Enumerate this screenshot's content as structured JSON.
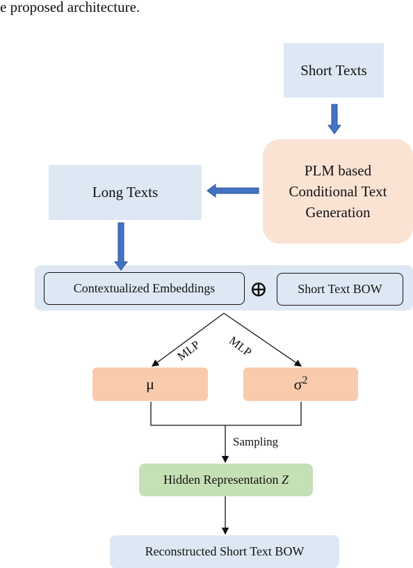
{
  "caption": "e proposed architecture.",
  "nodes": {
    "short_texts": "Short Texts",
    "plm": [
      "PLM based",
      "Conditional Text",
      "Generation"
    ],
    "long_texts": "Long Texts",
    "contextualized": "Contextualized Embeddings",
    "concat_symbol": "⊕",
    "short_bow": "Short Text BOW",
    "mu": "μ",
    "sigma": "σ",
    "sigma_exp": "2",
    "hidden": "Hidden Representation ",
    "hidden_var": "Z",
    "reconstructed": "Reconstructed Short Text BOW"
  },
  "edges": {
    "mlp_left": "MLP",
    "mlp_right": "MLP",
    "sampling": "Sampling"
  },
  "colors": {
    "arrow_blue": "#4472c4",
    "light_blue": "#dde8f4",
    "peach": "#fbe3d4",
    "orange": "#f8cbad",
    "green": "#c5e0b4"
  }
}
